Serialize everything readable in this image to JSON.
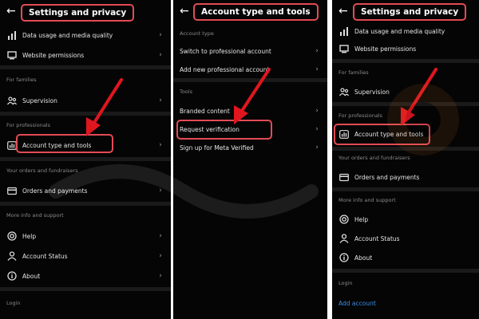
{
  "panel1": {
    "title": "Settings and privacy",
    "rows": [
      {
        "label": "Data usage and media quality"
      },
      {
        "label": "Website permissions"
      }
    ],
    "families_header": "For families",
    "supervision": "Supervision",
    "professionals_header": "For professionals",
    "account_type": "Account type and tools",
    "orders_header": "Your orders and fundraisers",
    "orders": "Orders and payments",
    "more_header": "More info and support",
    "help": "Help",
    "account_status": "Account Status",
    "about": "About",
    "login_header": "Login"
  },
  "panel2": {
    "title": "Account type and tools",
    "account_type_header": "Account type",
    "switch": "Switch to professional account",
    "add_new": "Add new professional account",
    "tools_header": "Tools",
    "branded": "Branded content",
    "request": "Request verification",
    "meta": "Sign up for Meta Verified"
  },
  "panel3": {
    "title": "Settings and privacy",
    "data_usage": "Data usage and media quality",
    "website": "Website permissions",
    "families_header": "For families",
    "supervision": "Supervision",
    "professionals_header": "For professionals",
    "account_type": "Account type and tools",
    "orders_header": "Your orders and fundraisers",
    "orders": "Orders and payments",
    "more_header": "More info and support",
    "help": "Help",
    "account_status": "Account Status",
    "about": "About",
    "login_header": "Login",
    "add_account": "Add account"
  },
  "colors": {
    "highlight": "#e34b55",
    "link": "#3b8de8",
    "background": "#050505"
  }
}
